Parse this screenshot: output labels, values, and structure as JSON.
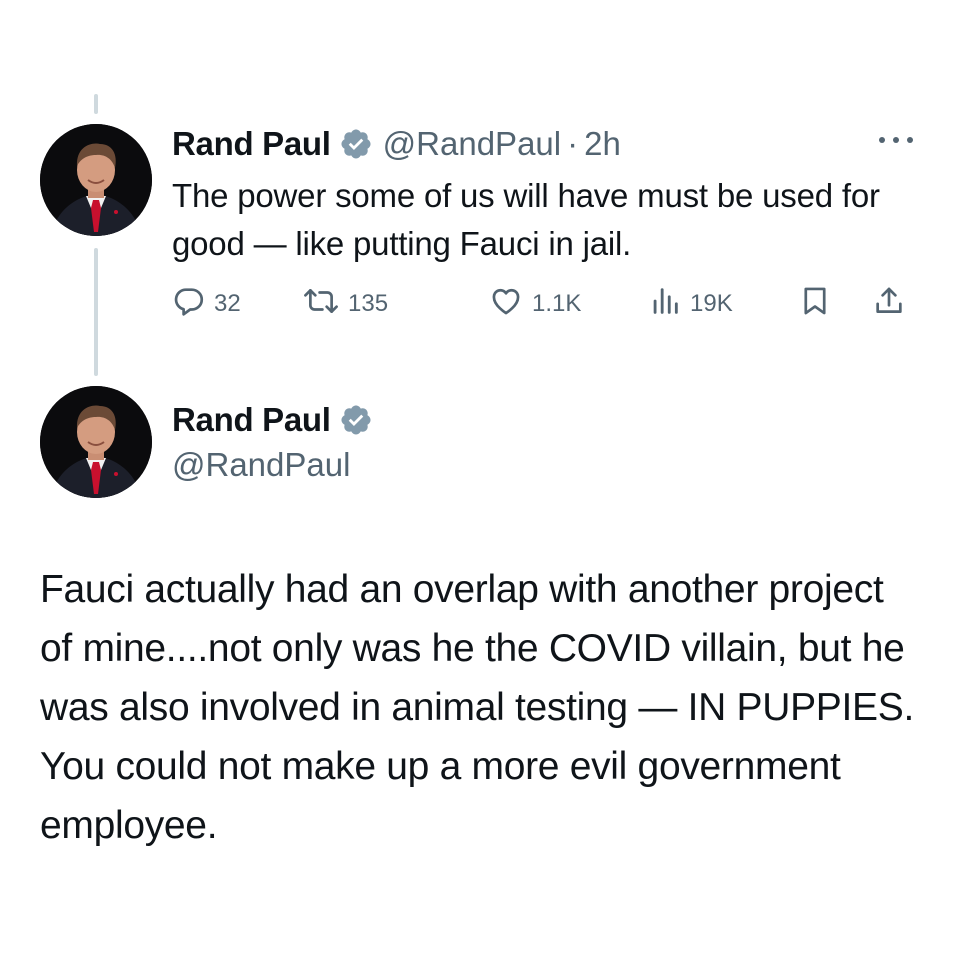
{
  "thread": {
    "reply_tweet": {
      "author": {
        "name": "Rand Paul",
        "handle": "@RandPaul",
        "verified": true,
        "avatar": "person-in-dark-suit-red-tie"
      },
      "separator": "·",
      "time": "2h",
      "text": "The power some of us will have must be used for good — like putting Fauci in jail.",
      "more_icon": "more-dots-icon",
      "actions": {
        "replies": "32",
        "reposts": "135",
        "likes": "1.1K",
        "views": "19K"
      }
    },
    "quoted_tweet": {
      "author": {
        "name": "Rand Paul",
        "handle": "@RandPaul",
        "verified": true,
        "avatar": "person-in-dark-suit-red-tie"
      },
      "text": "Fauci actually had an overlap with another project of mine....not only was he the COVID villain, but he was also involved in animal testing — IN PUPPIES. You could not make up a more evil government employee."
    }
  },
  "colors": {
    "text": "#0f1419",
    "secondary": "#536471",
    "thread_line": "#cfd9de",
    "verified_badge": "#829aab",
    "background": "#ffffff"
  }
}
